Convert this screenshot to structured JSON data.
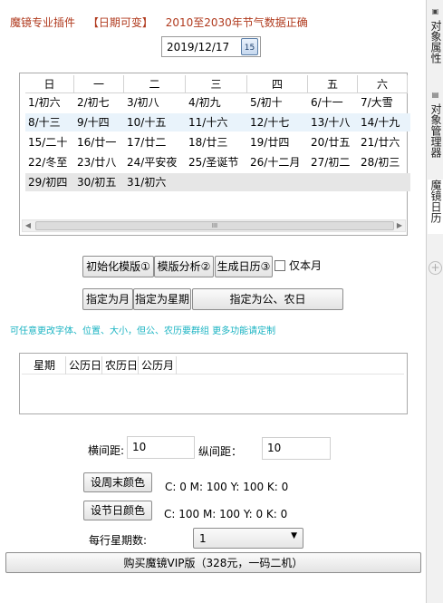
{
  "header": {
    "app": "魔镜专业插件",
    "tag": "【日期可变】",
    "desc": "2010至2030年节气数据正确"
  },
  "date_picker": {
    "value": "2019/12/17",
    "icon_text": "15"
  },
  "calendar": {
    "headers": [
      "日",
      "一",
      "二",
      "三",
      "四",
      "五",
      "六"
    ],
    "rows": [
      [
        "1/初六",
        "2/初七",
        "3/初八",
        "4/初九",
        "5/初十",
        "6/十一",
        "7/大雪"
      ],
      [
        "8/十三",
        "9/十四",
        "10/十五",
        "11/十六",
        "12/十七",
        "13/十八",
        "14/十九"
      ],
      [
        "15/二十",
        "16/廿一",
        "17/廿二",
        "18/廿三",
        "19/廿四",
        "20/廿五",
        "21/廿六"
      ],
      [
        "22/冬至",
        "23/廿八",
        "24/平安夜",
        "25/圣诞节",
        "26/十二月",
        "27/初二",
        "28/初三"
      ],
      [
        "29/初四",
        "30/初五",
        "31/初六",
        "",
        "",
        "",
        ""
      ]
    ],
    "scroll_thumb": "III"
  },
  "buttons": {
    "init_template": "初始化模版①",
    "template_analysis": "模版分析②",
    "generate_calendar": "生成日历③",
    "this_month_only": "仅本月",
    "set_month": "指定为月",
    "set_week": "指定为星期",
    "set_solar_lunar": "指定为公、农日"
  },
  "hint": "可任意更改字体、位置、大小，但公、农历要群组 更多功能请定制",
  "list": {
    "headers": [
      "星期",
      "公历日",
      "农历日",
      "公历月"
    ]
  },
  "spacing": {
    "h_label": "横间距:",
    "h_value": "10",
    "v_label": "纵间距：",
    "v_value": "10"
  },
  "weekend_color": {
    "button": "设周末颜色",
    "value": "C: 0   M: 100   Y: 100   K: 0"
  },
  "holiday_color": {
    "button": "设节日颜色",
    "value": "C: 100   M: 100   Y: 0   K: 0"
  },
  "weeks_per_row": {
    "label": "每行星期数:",
    "value": "1"
  },
  "vip_button": "购买魔镜VIP版（328元，一码二机）",
  "side_tabs": {
    "object_props": "对象属性",
    "object_manager": "对象管理器",
    "magic_calendar": "魔镜日历"
  },
  "colors": {
    "header_red": "#b03a1e",
    "hint_cyan": "#19b3c2",
    "selected_row": "#e9f3fb"
  }
}
